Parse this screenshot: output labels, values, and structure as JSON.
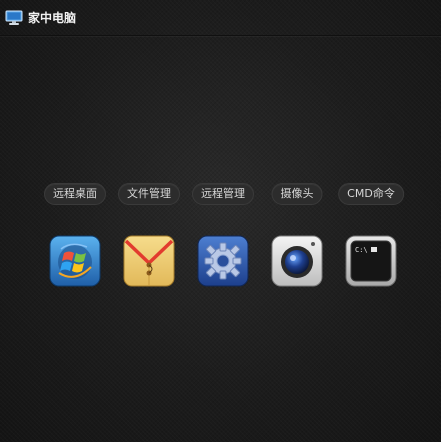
{
  "window": {
    "title": "家中电脑",
    "icon": "computer-monitor-icon"
  },
  "apps": [
    {
      "label": "远程桌面",
      "icon": "windows-logo-icon"
    },
    {
      "label": "文件管理",
      "icon": "envelope-file-icon"
    },
    {
      "label": "远程管理",
      "icon": "gear-icon"
    },
    {
      "label": "摄像头",
      "icon": "camera-icon"
    },
    {
      "label": "CMD命令",
      "icon": "terminal-icon"
    }
  ]
}
